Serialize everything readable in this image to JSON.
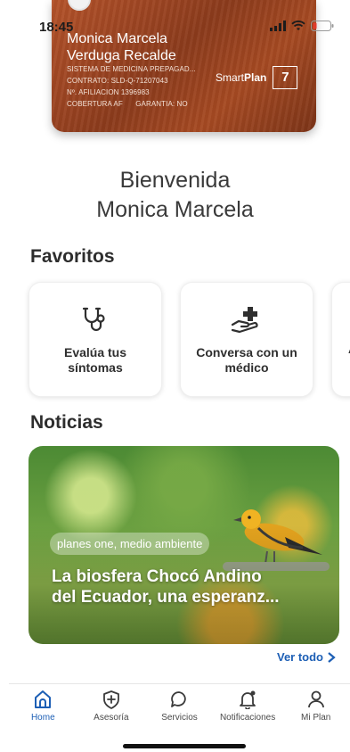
{
  "status_bar": {
    "time": "18:45"
  },
  "member_card": {
    "name_line1": "Monica Marcela",
    "name_line2": "Verduga Recalde",
    "company": "SISTEMA DE MEDICINA PREPAGAD...",
    "contract": "CONTRATO: SLD-Q-71207043",
    "affiliation": "Nº. AFILIACION 1396983",
    "coverage": "COBERTURA AF",
    "guarantee": "GARANTIA: NO",
    "plan_prefix": "Smart",
    "plan_bold": "Plan",
    "plan_number": "7"
  },
  "greeting": {
    "line1": "Bienvenida",
    "line2": "Monica Marcela"
  },
  "favorites": {
    "title": "Favoritos",
    "items": [
      {
        "label": "Evalúa tus síntomas",
        "icon": "stethoscope-icon"
      },
      {
        "label": "Conversa con un médico",
        "icon": "hand-plus-icon"
      }
    ],
    "partial_label": "A"
  },
  "news": {
    "title": "Noticias",
    "card": {
      "tag": "planes one, medio ambiente",
      "headline_line1": "La biosfera Chocó Andino",
      "headline_line2": "del Ecuador, una esperanz..."
    },
    "see_all": "Ver todo"
  },
  "bottom_nav": [
    {
      "label": "Home",
      "icon": "home-icon",
      "active": true
    },
    {
      "label": "Asesoría",
      "icon": "shield-plus-icon",
      "active": false
    },
    {
      "label": "Servicios",
      "icon": "chat-bubble-icon",
      "active": false
    },
    {
      "label": "Notificaciones",
      "icon": "bell-icon",
      "active": false
    },
    {
      "label": "Mi Plan",
      "icon": "user-icon",
      "active": false
    }
  ],
  "colors": {
    "accent": "#1d5fb5",
    "card": "#9a4522",
    "text": "#2d2d2d"
  }
}
